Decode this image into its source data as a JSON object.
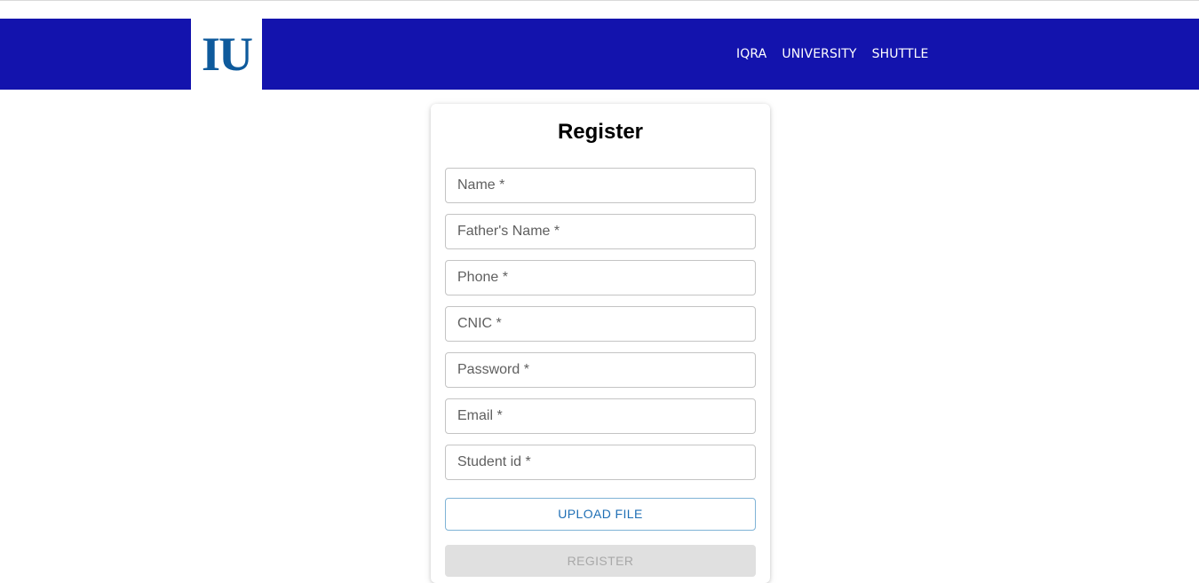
{
  "header": {
    "logo_text": "IU",
    "site_title": "IQRA  UNIVERSITY  SHUTTLE",
    "background_color": "#1313ad",
    "logo_color": "#0e5a9c"
  },
  "form": {
    "title": "Register",
    "fields": {
      "name": {
        "placeholder": "Name *",
        "value": ""
      },
      "father_name": {
        "placeholder": "Father's Name *",
        "value": ""
      },
      "phone": {
        "placeholder": "Phone *",
        "value": ""
      },
      "cnic": {
        "placeholder": "CNIC *",
        "value": ""
      },
      "password": {
        "placeholder": "Password *",
        "value": ""
      },
      "email": {
        "placeholder": "Email *",
        "value": ""
      },
      "student_id": {
        "placeholder": "Student id *",
        "value": ""
      }
    },
    "upload_label": "UPLOAD FILE",
    "register_label": "REGISTER",
    "accent_color": "#1f6fb5"
  }
}
